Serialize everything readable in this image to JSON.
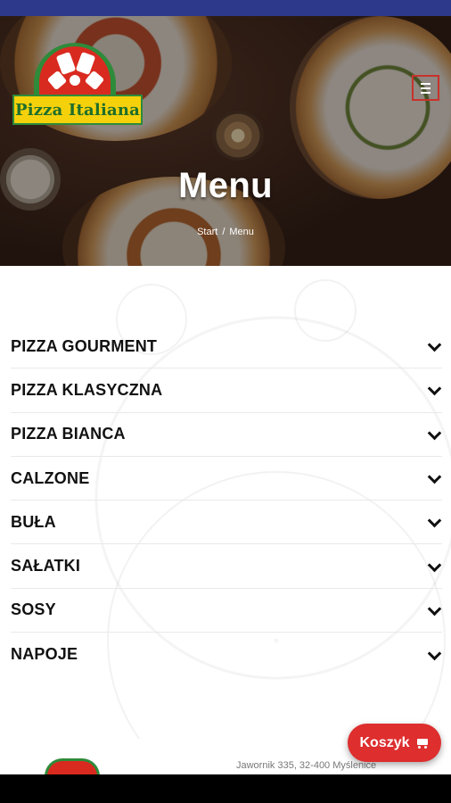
{
  "hero": {
    "logo_text": "Pizza Italiana",
    "title": "Menu",
    "breadcrumb": {
      "home": "Start",
      "separator": "/",
      "current": "Menu"
    }
  },
  "menu": {
    "categories": [
      {
        "label": "PIZZA GOURMENT"
      },
      {
        "label": "PIZZA KLASYCZNA"
      },
      {
        "label": "PIZZA BIANCA"
      },
      {
        "label": "CALZONE"
      },
      {
        "label": "BUŁA"
      },
      {
        "label": "SAŁATKI"
      },
      {
        "label": "SOSY"
      },
      {
        "label": "NAPOJE"
      }
    ]
  },
  "footer": {
    "address": "Jawornik 335, 32-400 Myślenice"
  },
  "cart": {
    "label": "Koszyk",
    "icon": "cart-icon"
  },
  "colors": {
    "accent": "#de2e2e",
    "status_bar": "#2d3a8c",
    "logo_green": "#2e8b3a",
    "logo_yellow": "#f5d10c"
  }
}
